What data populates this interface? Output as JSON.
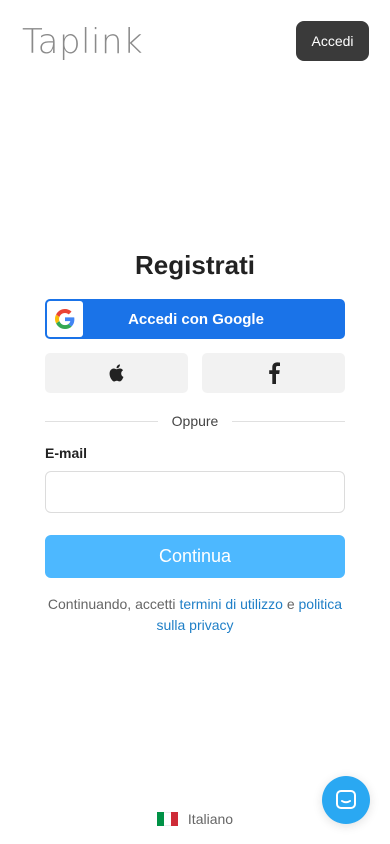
{
  "header": {
    "logo": "Taplink",
    "login_label": "Accedi"
  },
  "form": {
    "title": "Registrati",
    "google_label": "Accedi con Google",
    "divider_text": "Oppure",
    "email_label": "E-mail",
    "email_value": "",
    "continue_label": "Continua",
    "terms_prefix": "Continuando, accetti",
    "terms_link": "termini di utilizzo",
    "terms_and": "e",
    "privacy_link": "politica sulla privacy"
  },
  "footer": {
    "language": "Italiano"
  },
  "colors": {
    "google_blue": "#1a73e8",
    "continue": "#4db8ff",
    "chat": "#2aa8f2",
    "link": "#1f7fc7"
  }
}
